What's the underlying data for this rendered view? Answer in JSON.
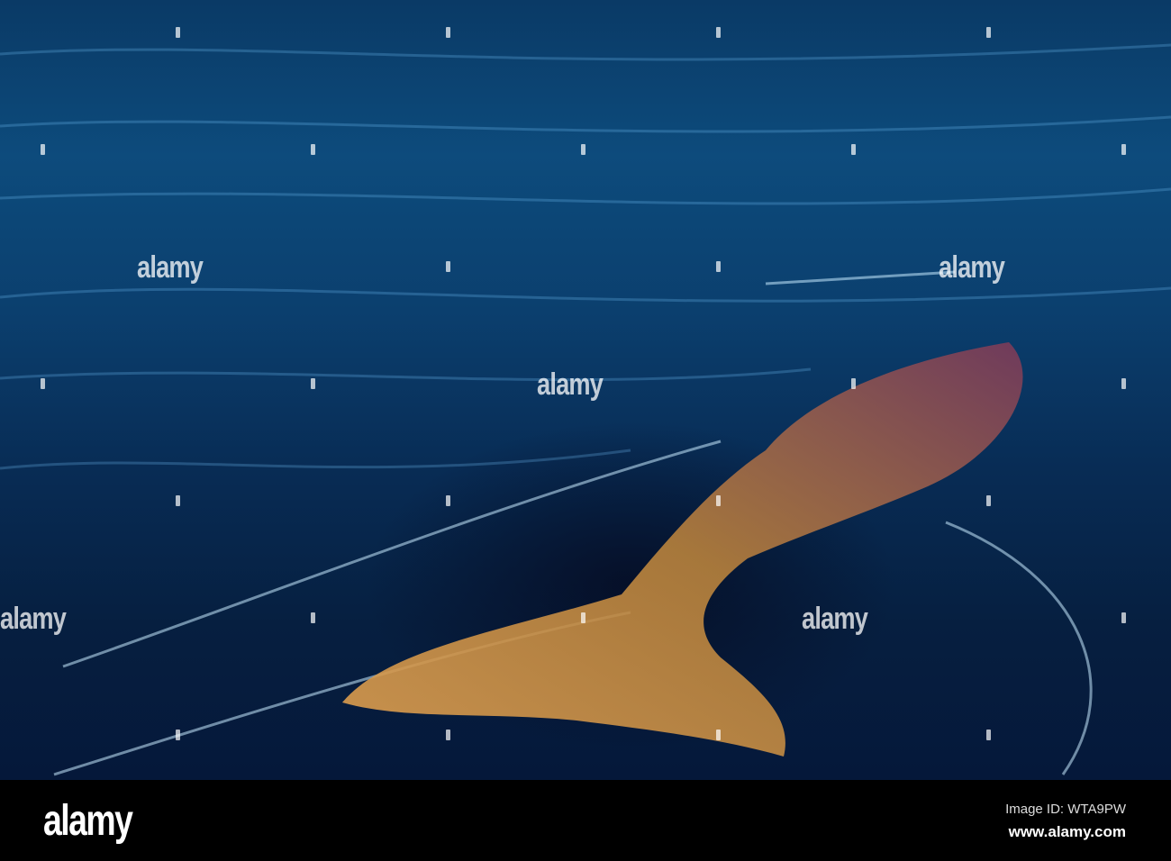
{
  "watermark": {
    "text": "alamy"
  },
  "footer": {
    "logo": "alamy",
    "image_id": "Image ID: WTA9PW",
    "site": "www.alamy.com"
  },
  "colors": {
    "water": "#0b3f6e",
    "whale": "#c98a3a",
    "bar": "#000000"
  }
}
